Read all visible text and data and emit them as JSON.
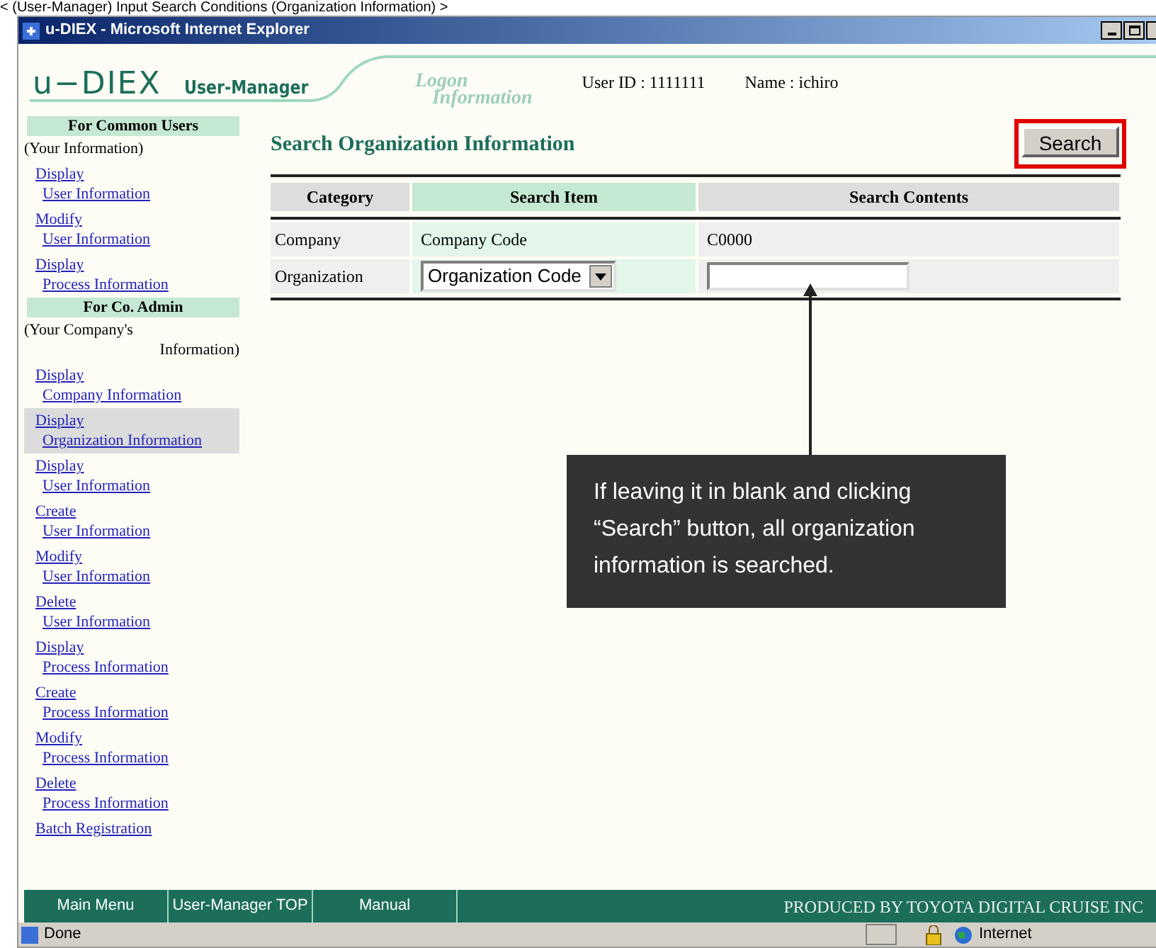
{
  "caption": "< (User-Manager) Input Search Conditions (Organization Information) >",
  "window": {
    "title": "u-DIEX - Microsoft Internet Explorer"
  },
  "header": {
    "logo": "u−DIEX",
    "app": "User-Manager",
    "logon_line1": "Logon",
    "logon_line2": "Information",
    "user_id": "User ID : 1111111",
    "name": "Name : ichiro"
  },
  "sidebar": [
    {
      "kind": "heading",
      "text": "For Common Users"
    },
    {
      "kind": "note",
      "text": "(Your Information)"
    },
    {
      "kind": "link",
      "verb": "Display",
      "object": "User Information",
      "selected": false
    },
    {
      "kind": "link",
      "verb": "Modify",
      "object": "User Information",
      "selected": false
    },
    {
      "kind": "link",
      "verb": "Display",
      "object": "Process Information",
      "selected": false
    },
    {
      "kind": "heading",
      "text": "For Co. Admin"
    },
    {
      "kind": "note",
      "text": "(Your Company's",
      "text2": "Information)"
    },
    {
      "kind": "link",
      "verb": "Display",
      "object": "Company Information",
      "selected": false
    },
    {
      "kind": "link",
      "verb": "Display",
      "object": "Organization Information",
      "selected": true
    },
    {
      "kind": "link",
      "verb": "Display",
      "object": "User Information",
      "selected": false
    },
    {
      "kind": "link",
      "verb": "Create",
      "object": "User Information",
      "selected": false
    },
    {
      "kind": "link",
      "verb": "Modify",
      "object": "User Information",
      "selected": false
    },
    {
      "kind": "link",
      "verb": "Delete",
      "object": "User Information",
      "selected": false
    },
    {
      "kind": "link",
      "verb": "Display",
      "object": "Process Information",
      "selected": false
    },
    {
      "kind": "link",
      "verb": "Create",
      "object": "Process Information",
      "selected": false
    },
    {
      "kind": "link",
      "verb": "Modify",
      "object": "Process Information",
      "selected": false
    },
    {
      "kind": "link",
      "verb": "Delete",
      "object": "Process Information",
      "selected": false
    },
    {
      "kind": "single",
      "verb": "Batch Registration",
      "selected": false
    }
  ],
  "main": {
    "title": "Search Organization Information",
    "search_button": "Search",
    "columns": [
      "Category",
      "Search Item",
      "Search Contents"
    ],
    "rows": [
      {
        "category": "Company",
        "item": "Company Code",
        "contents": "C0000",
        "kind": "text"
      },
      {
        "category": "Organization",
        "item": "Organization Code",
        "kind": "input"
      }
    ]
  },
  "callout": "If leaving it in blank and clicking “Search” button, all organization information is searched.",
  "footer": {
    "buttons": [
      "Main Menu",
      "User-Manager TOP",
      "Manual"
    ],
    "credit": "PRODUCED BY TOYOTA DIGITAL CRUISE INC"
  },
  "status_bar": {
    "text": "Done",
    "zone": "Internet"
  }
}
